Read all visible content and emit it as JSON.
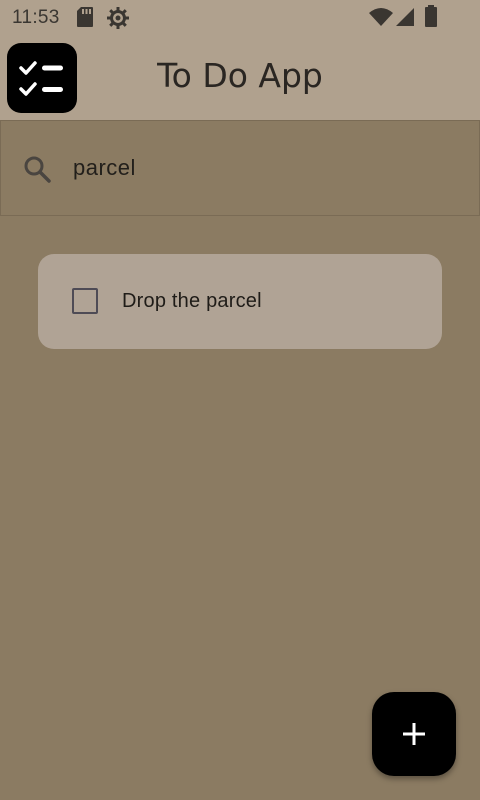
{
  "status_bar": {
    "time": "11:53",
    "left_icons": [
      "sd-card-icon",
      "settings-icon"
    ],
    "right_icons": [
      "wifi-icon",
      "cell-signal-icon",
      "battery-icon"
    ]
  },
  "app_bar": {
    "title": "To Do App",
    "logo_icon": "checklist-icon"
  },
  "search": {
    "icon": "search-icon",
    "value": "parcel"
  },
  "tasks": [
    {
      "label": "Drop the parcel",
      "checked": false
    }
  ],
  "fab": {
    "icon": "plus-icon"
  },
  "colors": {
    "background": "#8b7b62",
    "app_bar": "#b0a18e",
    "card": "#b0a395",
    "fab": "#000000"
  }
}
